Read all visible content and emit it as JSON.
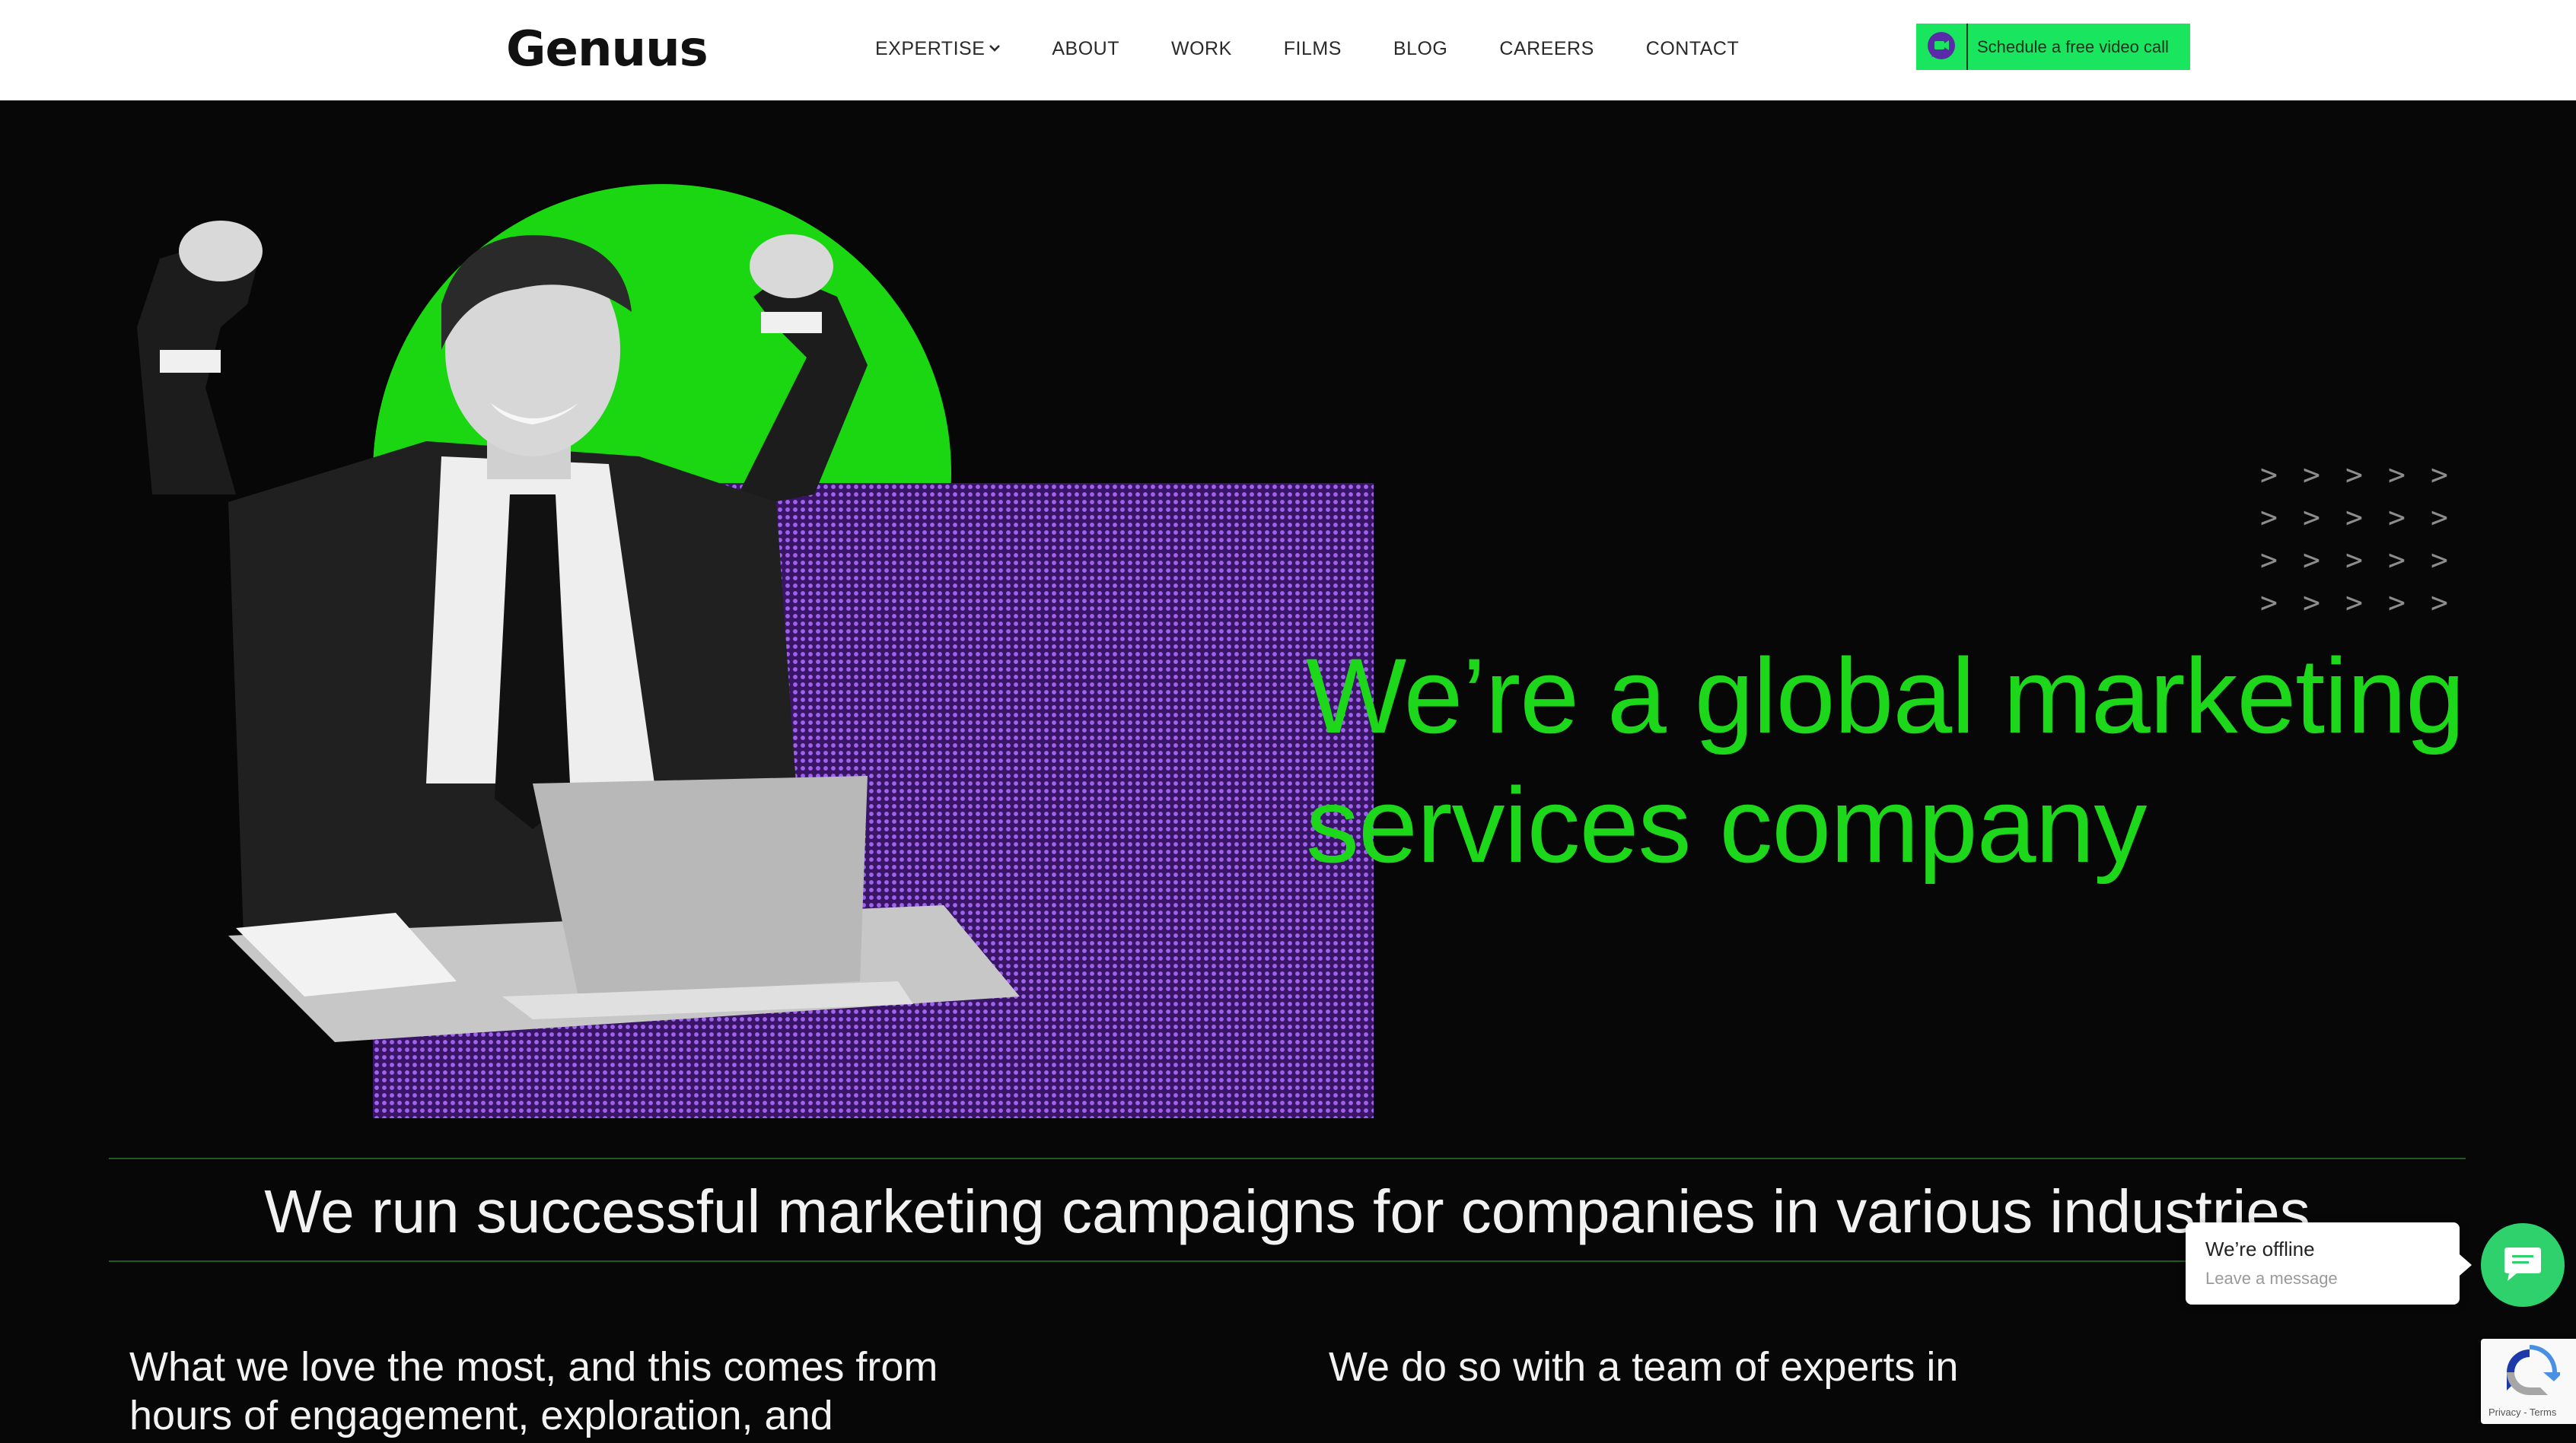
{
  "header": {
    "logo": "Genuus",
    "nav": [
      {
        "label": "EXPERTISE",
        "has_dropdown": true
      },
      {
        "label": "ABOUT"
      },
      {
        "label": "WORK"
      },
      {
        "label": "FILMS"
      },
      {
        "label": "BLOG"
      },
      {
        "label": "CAREERS"
      },
      {
        "label": "CONTACT"
      }
    ],
    "cta_label": "Schedule a free video call",
    "cta_icon": "video-chat-icon"
  },
  "hero": {
    "headline_line1": "We’re a global marketing",
    "headline_line2": "services company",
    "decor_arrows": [
      ">",
      ">",
      ">",
      ">",
      ">",
      ">",
      ">",
      ">",
      ">",
      ">",
      ">",
      ">",
      ">",
      ">",
      ">",
      ">",
      ">",
      ">",
      ">",
      ">"
    ]
  },
  "tagline": "We run successful marketing campaigns for companies in various industries",
  "intro": {
    "left_line1": "What we love the most, and this comes from",
    "left_line2": "hours of engagement, exploration, and",
    "right_line1": "We do so with a team of experts in"
  },
  "chat": {
    "title": "We’re offline",
    "subtitle": "Leave a message",
    "icon": "chat-icon"
  },
  "recaptcha": {
    "links": "Privacy - Terms",
    "icon": "recaptcha-icon"
  },
  "colors": {
    "accent_green": "#1cd71a",
    "cta_green": "#19e65e",
    "purple": "#9d63ea",
    "background": "#070707"
  }
}
